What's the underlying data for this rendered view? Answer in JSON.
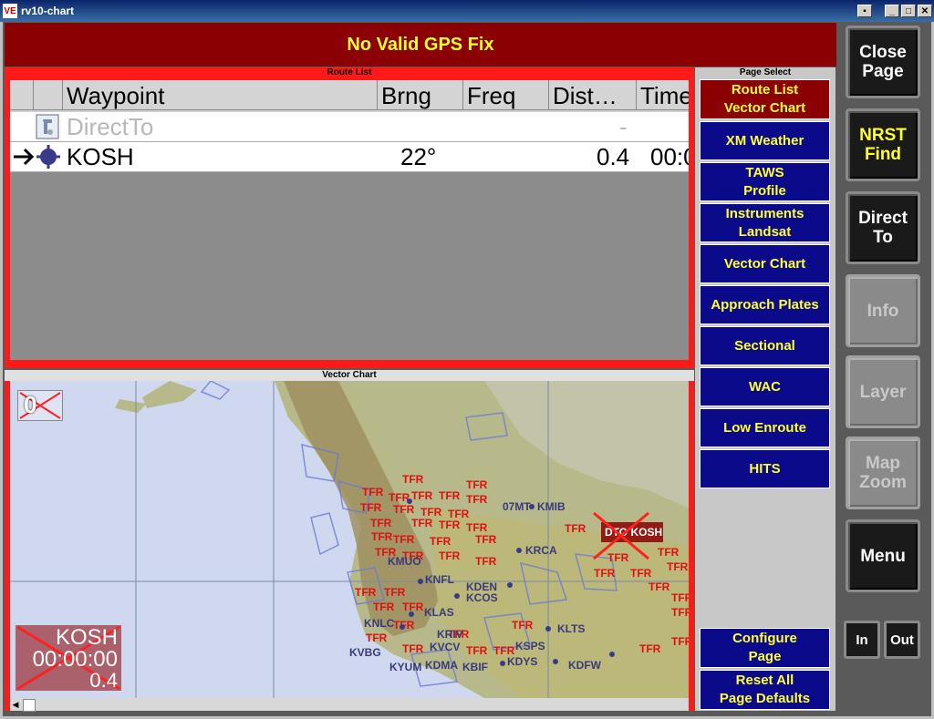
{
  "window": {
    "title": "rv10-chart",
    "app_icon": "VE",
    "buttons": [
      "menu",
      "minimize",
      "maximize",
      "close"
    ]
  },
  "gps_status": "No Valid GPS Fix",
  "route_list": {
    "title": "Route List",
    "columns": [
      "Waypoint",
      "Brng",
      "Freq",
      "Dist…",
      "Time"
    ],
    "rows": [
      {
        "waypoint": "DirectTo",
        "brng": "",
        "freq": "",
        "dist": "-",
        "time": ""
      },
      {
        "waypoint": "KOSH",
        "brng": "22°",
        "freq": "",
        "dist": "0.4",
        "time": "00:0"
      }
    ]
  },
  "vector_chart": {
    "title": "Vector Chart",
    "scale_label": "0",
    "info_box": {
      "waypoint": "KOSH",
      "time": "00:00:00",
      "dist": "0.4"
    },
    "airports": [
      "07MT",
      "KMIB",
      "KRCA",
      "KMUO",
      "KNFL",
      "KDEN",
      "KCOS",
      "KLAS",
      "KNLC",
      "KRIV",
      "KVCV",
      "KLTS",
      "KSPS",
      "KVBG",
      "KDMA",
      "KDYS",
      "KBIF",
      "KYUM",
      "KDFW",
      "KOSH",
      "DTO"
    ],
    "tfr_label": "TFR"
  },
  "page_select": {
    "title": "Page Select",
    "buttons": [
      {
        "line1": "Route List",
        "line2": "Vector Chart",
        "active": true
      },
      {
        "line1": "XM Weather",
        "line2": ""
      },
      {
        "line1": "TAWS",
        "line2": "Profile"
      },
      {
        "line1": "Instruments",
        "line2": "Landsat"
      },
      {
        "line1": "Vector Chart",
        "line2": ""
      },
      {
        "line1": "Approach Plates",
        "line2": ""
      },
      {
        "line1": "Sectional",
        "line2": ""
      },
      {
        "line1": "WAC",
        "line2": ""
      },
      {
        "line1": "Low Enroute",
        "line2": ""
      },
      {
        "line1": "HITS",
        "line2": ""
      }
    ],
    "configure": {
      "line1": "Configure",
      "line2": "Page"
    },
    "reset": {
      "line1": "Reset All",
      "line2": "Page Defaults"
    }
  },
  "side_buttons": {
    "close": {
      "line1": "Close",
      "line2": "Page"
    },
    "nrst": {
      "line1": "NRST",
      "line2": "Find"
    },
    "direct": {
      "line1": "Direct",
      "line2": "To"
    },
    "info": {
      "line1": "Info"
    },
    "layer": {
      "line1": "Layer"
    },
    "mapzoom": {
      "line1": "Map",
      "line2": "Zoom"
    },
    "menu": {
      "line1": "Menu"
    },
    "in": "In",
    "out": "Out"
  },
  "colors": {
    "gps_bar": "#8b0000",
    "gps_text": "#ffff33",
    "route_border": "#ff1a1a",
    "page_btn": "#0a0a8a",
    "page_btn_active": "#8b0000",
    "tfr": "#e01010",
    "airport": "#3a3a7a"
  }
}
